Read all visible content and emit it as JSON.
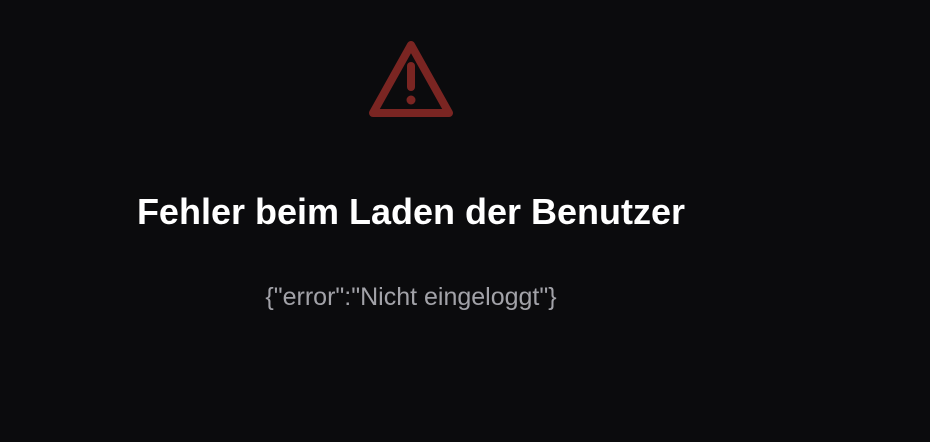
{
  "error": {
    "icon": "warning-triangle-icon",
    "icon_color": "#7a2522",
    "title": "Fehler beim Laden der Benutzer",
    "message": "{\"error\":\"Nicht eingeloggt\"}"
  },
  "colors": {
    "background": "#0b0b0d",
    "title": "#ffffff",
    "message": "#a2a2a8"
  }
}
